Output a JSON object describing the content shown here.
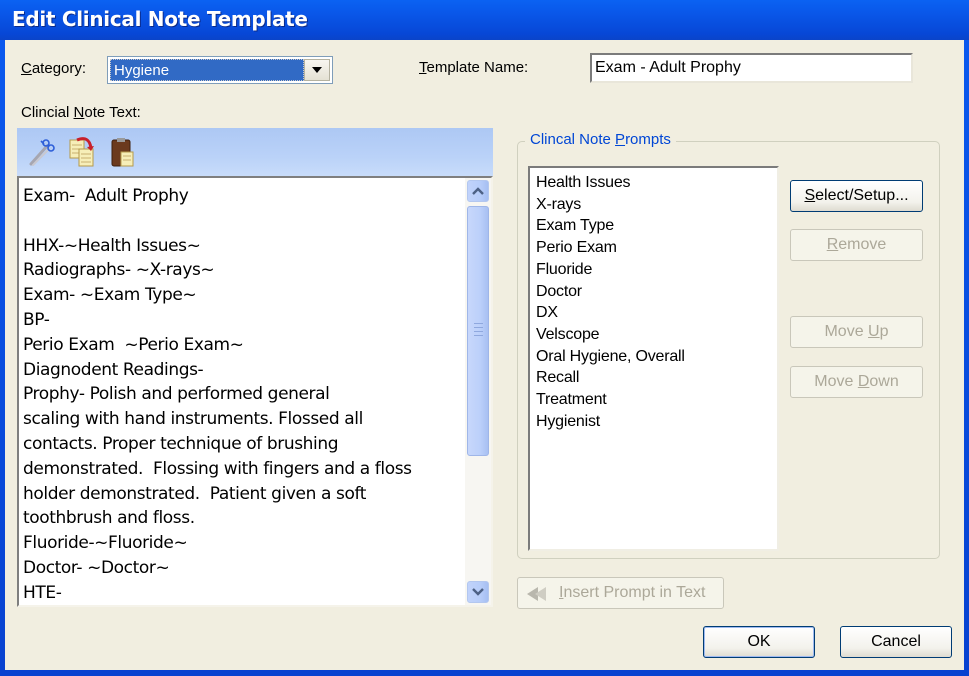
{
  "window": {
    "title": "Edit Clinical Note Template"
  },
  "form": {
    "category_label_prefix": "",
    "category_label_mnemonic": "C",
    "category_label_rest": "ategory:",
    "category_value": "Hygiene",
    "template_name_label_mnemonic": "T",
    "template_name_label_rest": "emplate Name:",
    "template_name_value": "Exam -  Adult Prophy",
    "note_text_label_prefix": "Clincial ",
    "note_text_label_mnemonic": "N",
    "note_text_label_rest": "ote Text:"
  },
  "toolbar": {
    "icons": [
      "cut-icon",
      "copy-icon",
      "paste-icon"
    ]
  },
  "editor": {
    "text": "Exam-  Adult Prophy\n\nHHX-~Health Issues~\nRadiographs- ~X-rays~\nExam- ~Exam Type~\nBP-\nPerio Exam  ~Perio Exam~\nDiagnodent Readings-\nProphy- Polish and performed general\nscaling with hand instruments. Flossed all\ncontacts. Proper technique of brushing\ndemonstrated.  Flossing with fingers and a floss\nholder demonstrated.  Patient given a soft\ntoothbrush and floss.\nFluoride-~Fluoride~\nDoctor- ~Doctor~\nHTE-"
  },
  "prompts": {
    "group_title_prefix": "Clincal Note ",
    "group_title_mnemonic": "P",
    "group_title_rest": "rompts",
    "items": [
      "Health Issues",
      "X-rays",
      "Exam Type",
      "Perio Exam",
      "Fluoride",
      "Doctor",
      "DX",
      "Velscope",
      "Oral Hygiene, Overall",
      "Recall",
      "Treatment",
      "Hygienist"
    ],
    "select_setup": {
      "mnemonic": "S",
      "rest": "elect/Setup..."
    },
    "remove": {
      "mnemonic": "R",
      "rest": "emove"
    },
    "move_up": {
      "prefix": "Move ",
      "mnemonic": "U",
      "rest": "p"
    },
    "move_down": {
      "prefix": "Move ",
      "mnemonic": "D",
      "rest": "own"
    }
  },
  "actions": {
    "insert_prompt": {
      "mnemonic": "I",
      "rest": "nsert Prompt in Text"
    },
    "ok": "OK",
    "cancel": "Cancel"
  }
}
